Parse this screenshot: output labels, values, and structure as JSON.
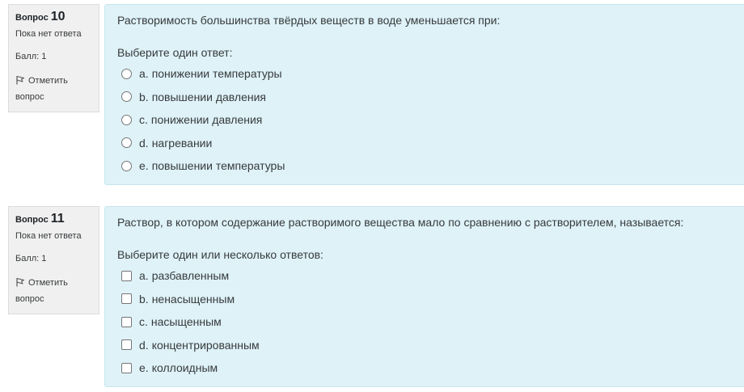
{
  "questions": [
    {
      "number_label": "Вопрос",
      "number": "10",
      "state": "Пока нет ответа",
      "grade": "Балл: 1",
      "flag_label": "Отметить вопрос",
      "text": "Растворимость большинства твёрдых веществ в воде уменьшается при:",
      "prompt": "Выберите один ответ:",
      "input_type": "radio",
      "answers": [
        {
          "letter": "a.",
          "text": "понижении температуры"
        },
        {
          "letter": "b.",
          "text": "повышении давления"
        },
        {
          "letter": "c.",
          "text": "понижении давления"
        },
        {
          "letter": "d.",
          "text": "нагревании"
        },
        {
          "letter": "e.",
          "text": "повышении температуры"
        }
      ]
    },
    {
      "number_label": "Вопрос",
      "number": "11",
      "state": "Пока нет ответа",
      "grade": "Балл: 1",
      "flag_label": "Отметить вопрос",
      "text": "Раствор, в котором содержание растворимого вещества мало по сравнению с растворителем, называется:",
      "prompt": "Выберите один или несколько ответов:",
      "input_type": "checkbox",
      "answers": [
        {
          "letter": "a.",
          "text": "разбавленным"
        },
        {
          "letter": "b.",
          "text": "ненасыщенным"
        },
        {
          "letter": "c.",
          "text": "насыщенным"
        },
        {
          "letter": "d.",
          "text": "концентрированным"
        },
        {
          "letter": "e.",
          "text": "коллоидным"
        }
      ]
    }
  ]
}
